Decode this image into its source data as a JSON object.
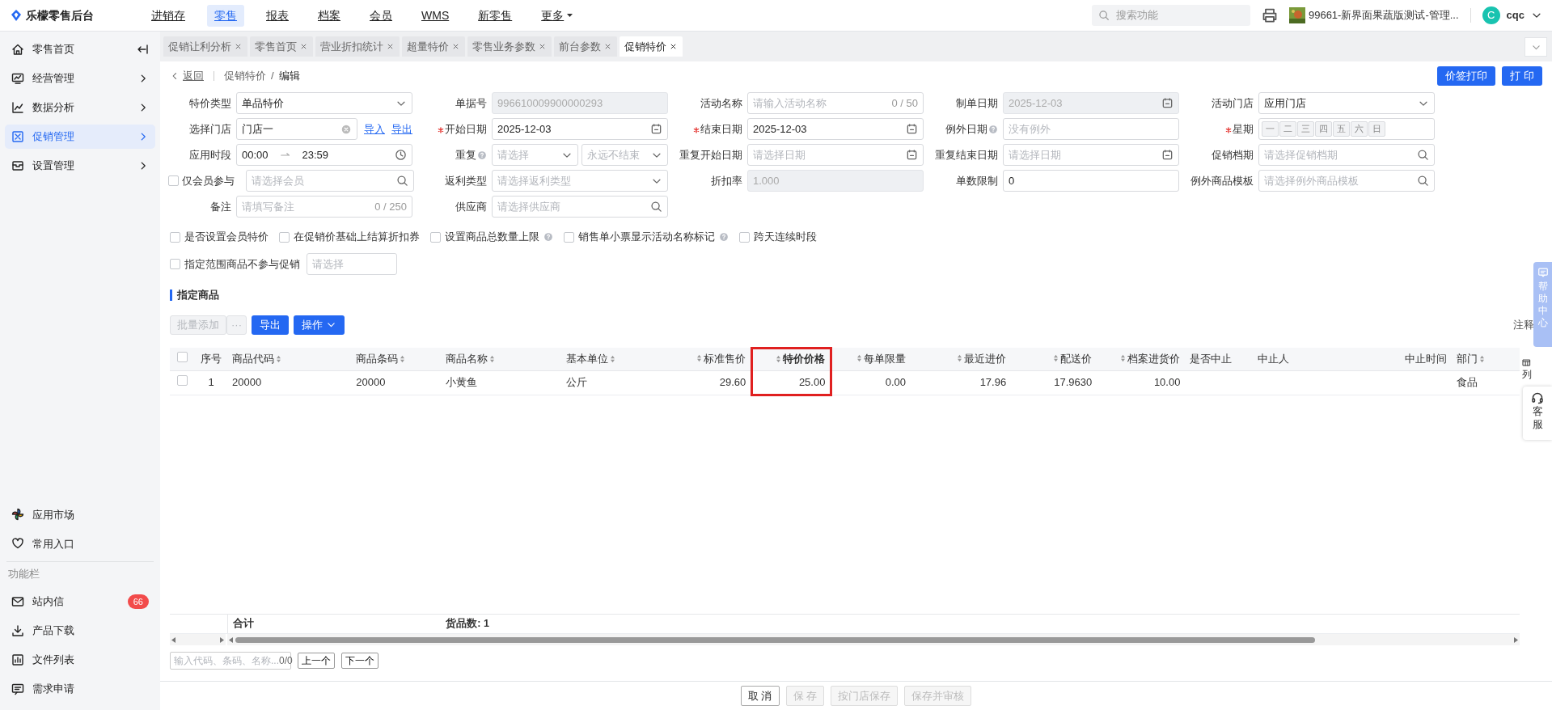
{
  "brand": {
    "name": "乐檬零售后台"
  },
  "top_nav": [
    {
      "label": "进销存",
      "selected": false,
      "kind": "link"
    },
    {
      "label": "零售",
      "selected": true,
      "kind": "link"
    },
    {
      "label": "报表",
      "selected": false,
      "kind": "link"
    },
    {
      "label": "档案",
      "selected": false,
      "kind": "link"
    },
    {
      "label": "会员",
      "selected": false,
      "kind": "link"
    },
    {
      "label": "WMS",
      "selected": false,
      "kind": "link"
    },
    {
      "label": "新零售",
      "selected": false,
      "kind": "link"
    },
    {
      "label": "更多",
      "selected": false,
      "kind": "menu"
    }
  ],
  "search": {
    "placeholder": "搜索功能"
  },
  "store": {
    "label": "99661-新界面果蔬版测试-管理..."
  },
  "user": {
    "initial": "C",
    "name": "cqc"
  },
  "sidebar": {
    "items": [
      {
        "label": "零售首页",
        "kind": "pin",
        "selected": false
      },
      {
        "label": "经营管理",
        "kind": "group",
        "selected": false
      },
      {
        "label": "数据分析",
        "kind": "group",
        "selected": false
      },
      {
        "label": "促销管理",
        "kind": "group",
        "selected": true
      },
      {
        "label": "设置管理",
        "kind": "group",
        "selected": false
      }
    ],
    "bottom_items": [
      {
        "label": "应用市场"
      },
      {
        "label": "常用入口"
      }
    ],
    "section_label": "功能栏",
    "tool_items": [
      {
        "label": "站内信",
        "badge": "66"
      },
      {
        "label": "产品下载"
      },
      {
        "label": "文件列表"
      },
      {
        "label": "需求申请"
      }
    ]
  },
  "tabs": [
    {
      "label": "促销让利分析",
      "selected": false
    },
    {
      "label": "零售首页",
      "selected": false
    },
    {
      "label": "营业折扣统计",
      "selected": false
    },
    {
      "label": "超量特价",
      "selected": false
    },
    {
      "label": "零售业务参数",
      "selected": false
    },
    {
      "label": "前台参数",
      "selected": false
    },
    {
      "label": "促销特价",
      "selected": true
    }
  ],
  "breadcrumb": {
    "back": "返回",
    "parent": "促销特价",
    "separator": "/",
    "current": "编辑"
  },
  "header_buttons": [
    "价签打印",
    "打 印"
  ],
  "form": {
    "fields": [
      {
        "label": "特价类型",
        "kind": "select",
        "value": "单品特价",
        "required": false,
        "help": false,
        "readonly": false
      },
      {
        "label": "单据号",
        "kind": "text",
        "value": "996610009900000293",
        "required": false,
        "help": false,
        "readonly": true
      },
      {
        "label": "活动名称",
        "kind": "counter",
        "placeholder": "请输入活动名称",
        "counter": "0 / 50",
        "required": false,
        "help": false,
        "readonly": false
      },
      {
        "label": "制单日期",
        "kind": "date",
        "value": "2025-12-03",
        "required": false,
        "help": false,
        "readonly": true
      },
      {
        "label": "活动门店",
        "kind": "select",
        "value": "应用门店",
        "required": false,
        "help": false,
        "readonly": false
      },
      {
        "label": "选择门店",
        "kind": "store",
        "value": "门店一",
        "links": [
          "导入",
          "导出"
        ],
        "required": false,
        "help": false,
        "readonly": false
      },
      {
        "label": "开始日期",
        "kind": "date",
        "value": "2025-12-03",
        "required": true,
        "help": false,
        "readonly": false
      },
      {
        "label": "结束日期",
        "kind": "date",
        "value": "2025-12-03",
        "required": true,
        "help": false,
        "readonly": false
      },
      {
        "label": "例外日期",
        "kind": "text",
        "placeholder": "没有例外",
        "required": false,
        "help": true,
        "readonly": false
      },
      {
        "label": "星期",
        "kind": "weekdays",
        "days": [
          "一",
          "二",
          "三",
          "四",
          "五",
          "六",
          "日"
        ],
        "required": true,
        "help": false,
        "readonly": false
      },
      {
        "label": "应用时段",
        "kind": "time_range",
        "start": "00:00",
        "end": "23:59",
        "required": false,
        "help": false,
        "readonly": false
      },
      {
        "label": "重复",
        "kind": "double_select",
        "placeholders": [
          "请选择",
          "永远不结束"
        ],
        "required": false,
        "help": true,
        "readonly": false
      },
      {
        "label": "重复开始日期",
        "kind": "date",
        "placeholder": "请选择日期",
        "required": false,
        "help": false,
        "readonly": false
      },
      {
        "label": "重复结束日期",
        "kind": "date",
        "placeholder": "请选择日期",
        "required": false,
        "help": false,
        "readonly": false
      },
      {
        "label": "促销档期",
        "kind": "search",
        "placeholder": "请选择促销档期",
        "required": false,
        "help": false,
        "readonly": false
      },
      {
        "label": "仅会员参与",
        "kind": "checkbox_search",
        "checked": false,
        "placeholder": "请选择会员",
        "readonly": false
      },
      {
        "label": "返利类型",
        "kind": "select",
        "placeholder": "请选择返利类型",
        "required": false,
        "help": false,
        "readonly": false
      },
      {
        "label": "折扣率",
        "kind": "text",
        "value": "1.000",
        "required": false,
        "help": false,
        "readonly": true
      },
      {
        "label": "单数限制",
        "kind": "text",
        "value": "0",
        "required": false,
        "help": false,
        "readonly": false
      },
      {
        "label": "例外商品模板",
        "kind": "search",
        "placeholder": "请选择例外商品模板",
        "required": false,
        "help": false,
        "readonly": false
      },
      {
        "label": "备注",
        "kind": "counter",
        "placeholder": "请填写备注",
        "counter": "0 / 250",
        "required": false,
        "help": false,
        "readonly": false
      },
      {
        "label": "供应商",
        "kind": "search",
        "placeholder": "请选择供应商",
        "required": false,
        "help": false,
        "readonly": false
      }
    ],
    "options": [
      {
        "label": "是否设置会员特价",
        "checked": false,
        "help": false
      },
      {
        "label": "在促销价基础上结算折扣券",
        "checked": false,
        "help": false
      },
      {
        "label": "设置商品总数量上限",
        "checked": false,
        "help": true
      },
      {
        "label": "销售单小票显示活动名称标记",
        "checked": false,
        "help": true
      },
      {
        "label": "跨天连续时段",
        "checked": false,
        "help": false
      }
    ],
    "exclude": {
      "label": "指定范围商品不参与促销",
      "checked": false,
      "placeholder": "请选择"
    }
  },
  "goods": {
    "title": "指定商品",
    "toolbar": [
      {
        "label": "批量添加",
        "kind": "button",
        "disabled": true
      },
      {
        "label": "···",
        "kind": "more",
        "disabled": true
      },
      {
        "label": "导出",
        "kind": "button",
        "disabled": false
      },
      {
        "label": "操作",
        "kind": "menu",
        "disabled": false
      }
    ],
    "note": "注释",
    "table": {
      "all_selected": false,
      "columns": [
        {
          "label": "序号",
          "kind": "index",
          "sortable": false,
          "highlighted": false
        },
        {
          "label": "商品代码",
          "kind": "text",
          "sortable": true,
          "highlighted": false
        },
        {
          "label": "商品条码",
          "kind": "text",
          "sortable": true,
          "highlighted": false
        },
        {
          "label": "商品名称",
          "kind": "text",
          "sortable": true,
          "highlighted": false
        },
        {
          "label": "基本单位",
          "kind": "text",
          "sortable": true,
          "highlighted": false
        },
        {
          "label": "标准售价",
          "kind": "number",
          "sortable": true,
          "highlighted": false
        },
        {
          "label": "特价价格",
          "kind": "number",
          "sortable": true,
          "highlighted": true
        },
        {
          "label": "每单限量",
          "kind": "number",
          "sortable": true,
          "highlighted": false
        },
        {
          "label": "最近进价",
          "kind": "number",
          "sortable": true,
          "highlighted": false
        },
        {
          "label": "配送价",
          "kind": "number",
          "sortable": true,
          "highlighted": false
        },
        {
          "label": "档案进货价",
          "kind": "number",
          "sortable": true,
          "highlighted": false
        },
        {
          "label": "是否中止",
          "kind": "text",
          "sortable": false,
          "highlighted": false
        },
        {
          "label": "中止人",
          "kind": "text",
          "sortable": false,
          "highlighted": false
        },
        {
          "label": "中止时间",
          "kind": "number",
          "sortable": false,
          "highlighted": false
        },
        {
          "label": "部门",
          "kind": "text",
          "sortable": true,
          "highlighted": false
        }
      ],
      "rows": [
        {
          "selected": false,
          "cells": [
            "1",
            "20000",
            "20000",
            "小黄鱼",
            "公斤",
            "29.60",
            "25.00",
            "0.00",
            "17.96",
            "17.9630",
            "10.00",
            null,
            null,
            null,
            "食品"
          ]
        }
      ],
      "footer": {
        "label": "合计",
        "count": "货品数: 1"
      }
    },
    "finder": {
      "placeholder": "输入代码、条码、名称...",
      "counter": "0/0",
      "prev": "上一个",
      "next": "下一个"
    }
  },
  "footer_buttons": [
    {
      "label": "取 消",
      "disabled": false
    },
    {
      "label": "保 存",
      "disabled": true
    },
    {
      "label": "按门店保存",
      "disabled": true
    },
    {
      "label": "保存并审核",
      "disabled": true
    }
  ],
  "side_widgets": {
    "help": "帮助中心",
    "columns": "列",
    "service": "客服"
  }
}
